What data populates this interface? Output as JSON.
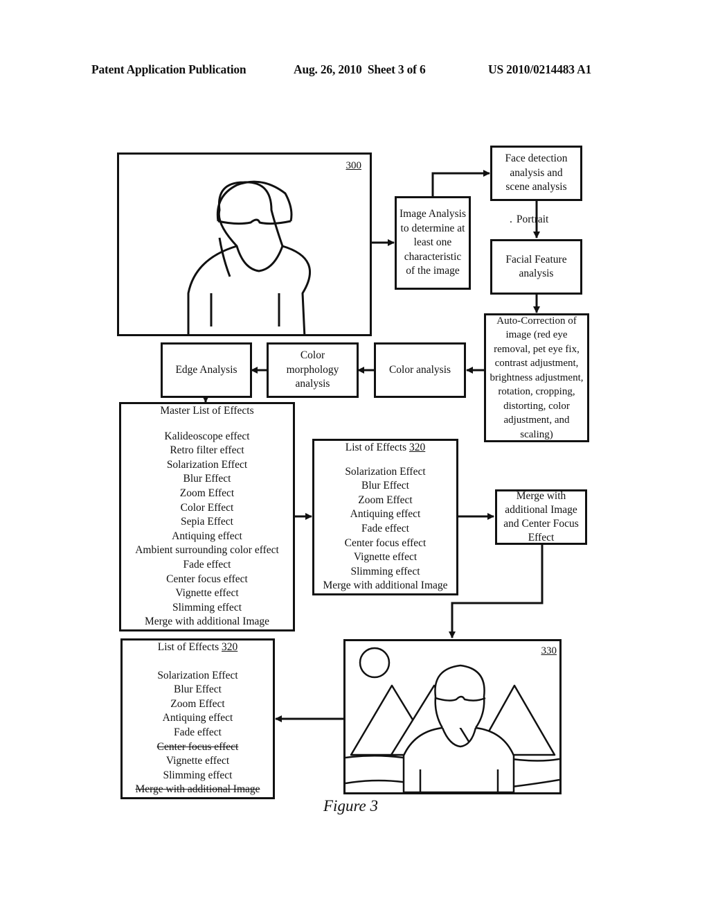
{
  "header": {
    "publication_label": "Patent Application Publication",
    "date_sheet": "Aug. 26, 2010  Sheet 3 of 6",
    "patent_number": "US 2010/0214483 A1"
  },
  "figure_caption": "Figure 3",
  "original_image": {
    "ref": "300",
    "icon": "person-portrait-icon"
  },
  "boxes": {
    "image_analysis": "Image Analysis to determine at least one characteristic of the image",
    "face_detection": "Face detection analysis and scene analysis",
    "portrait_label": "Portrait",
    "facial_feature": "Facial Feature analysis",
    "auto_correction": "Auto-Correction of image (red eye removal, pet eye fix, contrast adjustment, brightness adjustment, rotation, cropping, distorting, color adjustment, and scaling)",
    "color_analysis": "Color analysis",
    "color_morphology": "Color morphology analysis",
    "edge_analysis": "Edge Analysis",
    "merge_box": "Merge with additional Image and Center Focus Effect"
  },
  "master_list": {
    "title": "Master List of Effects",
    "items": [
      "Kalideoscope effect",
      "Retro filter effect",
      "Solarization Effect",
      "Blur Effect",
      "Zoom Effect",
      "Color Effect",
      "Sepia Effect",
      "Antiquing effect",
      "Ambient surrounding color effect",
      "Fade effect",
      "Center focus effect",
      "Vignette effect",
      "Slimming effect",
      "Merge with additional Image"
    ]
  },
  "effects_list_320": {
    "title": "List of Effects",
    "ref": "320",
    "items": [
      "Solarization Effect",
      "Blur Effect",
      "Zoom Effect",
      "Antiquing effect",
      "Fade effect",
      "Center focus effect",
      "Vignette effect",
      "Slimming effect",
      "Merge with additional Image"
    ]
  },
  "effects_list_320_updated": {
    "title": "List of Effects",
    "ref": "320",
    "items": [
      {
        "label": "Solarization Effect",
        "struck": false
      },
      {
        "label": "Blur Effect",
        "struck": false
      },
      {
        "label": "Zoom Effect",
        "struck": false
      },
      {
        "label": "Antiquing effect",
        "struck": false
      },
      {
        "label": "Fade effect",
        "struck": false
      },
      {
        "label": "Center focus effect",
        "struck": true
      },
      {
        "label": "Vignette effect",
        "struck": false
      },
      {
        "label": "Slimming effect",
        "struck": false
      },
      {
        "label": "Merge with additional Image",
        "struck": true
      }
    ]
  },
  "result_image": {
    "ref": "330",
    "icon": "person-mountain-scene-icon"
  }
}
